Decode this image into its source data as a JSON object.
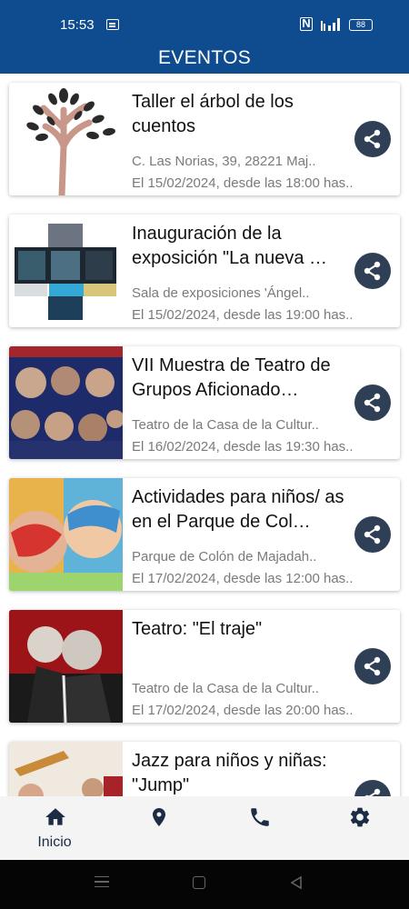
{
  "status_bar": {
    "time": "15:53",
    "battery": "88",
    "icons": [
      "message-icon",
      "nfc-icon",
      "signal-4g-icon",
      "battery-icon"
    ]
  },
  "header": {
    "title": "EVENTOS"
  },
  "events": [
    {
      "title": "Taller el árbol de los cuentos",
      "venue": "C. Las Norias, 39, 28221 Maj..",
      "date": "El 15/02/2024, desde las 18:00 has..",
      "thumbnail": "tree-illustration"
    },
    {
      "title": "Inauguración de la exposición \"La nueva …",
      "venue": "Sala de exposiciones 'Ángel..",
      "date": "El 15/02/2024, desde las 19:00 has..",
      "thumbnail": "exhibition-collage"
    },
    {
      "title": "VII Muestra de Teatro de Grupos Aficionado…",
      "venue": "Teatro de la Casa de la Cultur..",
      "date": "El 16/02/2024, desde las 19:30 has..",
      "thumbnail": "theatre-poster"
    },
    {
      "title": "Actividades para niños/ as en el Parque de Col…",
      "venue": "Parque de Colón de Majadah..",
      "date": "El 17/02/2024, desde las 12:00 has..",
      "thumbnail": "kids-face-paint"
    },
    {
      "title": "Teatro: \"El traje\"",
      "venue": "Teatro de la Casa de la Cultur..",
      "date": "El 17/02/2024, desde las 20:00 has..",
      "thumbnail": "theatre-red-poster"
    },
    {
      "title": "Jazz para niños y niñas: \"Jump\"",
      "venue": "",
      "date": "",
      "thumbnail": "jazz-band"
    }
  ],
  "bottom_nav": {
    "items": [
      {
        "label": "Inicio",
        "icon": "home-icon",
        "active": true
      },
      {
        "label": "",
        "icon": "location-pin-icon",
        "active": false
      },
      {
        "label": "",
        "icon": "phone-icon",
        "active": false
      },
      {
        "label": "",
        "icon": "gear-icon",
        "active": false
      }
    ]
  },
  "colors": {
    "header_bg": "#0e4b8f",
    "share_button_bg": "#2f3f55",
    "nav_icon": "#1b2c44",
    "secondary_text": "#7a7a7a"
  }
}
